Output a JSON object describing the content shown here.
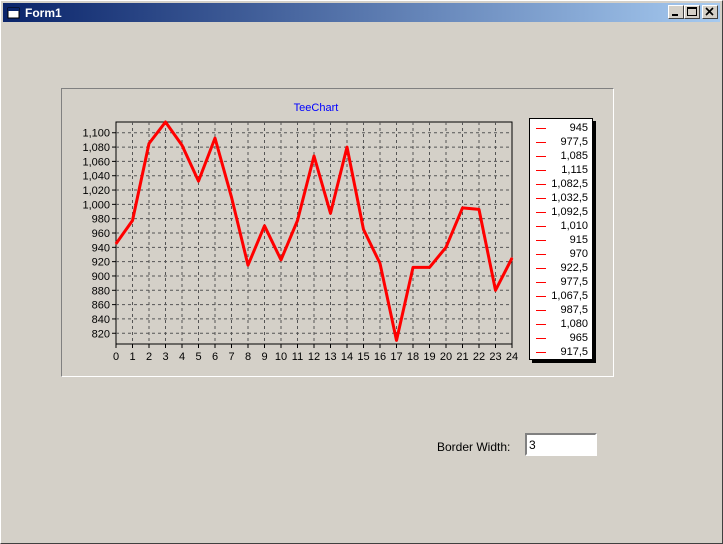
{
  "window": {
    "title": "Form1"
  },
  "chart_data": {
    "type": "line",
    "title": "TeeChart",
    "x": [
      0,
      1,
      2,
      3,
      4,
      5,
      6,
      7,
      8,
      9,
      10,
      11,
      12,
      13,
      14,
      15,
      16,
      17,
      18,
      19,
      20,
      21,
      22,
      23,
      24
    ],
    "series": [
      {
        "values": [
          945,
          977.5,
          1085,
          1115,
          1082.5,
          1032.5,
          1092.5,
          1010,
          915,
          970,
          922.5,
          977.5,
          1067.5,
          987.5,
          1080,
          965,
          917.5,
          810,
          912,
          912,
          940,
          995,
          993,
          880,
          925
        ],
        "color": "#ff0000"
      }
    ],
    "xticks": [
      "0",
      "1",
      "2",
      "3",
      "4",
      "5",
      "6",
      "7",
      "8",
      "9",
      "10",
      "11",
      "12",
      "13",
      "14",
      "15",
      "16",
      "17",
      "18",
      "19",
      "20",
      "21",
      "22",
      "23",
      "24"
    ],
    "yticks": [
      "820",
      "840",
      "860",
      "880",
      "900",
      "920",
      "940",
      "960",
      "980",
      "1,000",
      "1,020",
      "1,040",
      "1,060",
      "1,080",
      "1,100"
    ],
    "ylim": [
      805,
      1115
    ],
    "grid": true,
    "legend": [
      "945",
      "977,5",
      "1,085",
      "1,115",
      "1,082,5",
      "1,032,5",
      "1,092,5",
      "1,010",
      "915",
      "970",
      "922,5",
      "977,5",
      "1,067,5",
      "987,5",
      "1,080",
      "965",
      "917,5"
    ]
  },
  "form": {
    "border_width_label": "Border Width:",
    "border_width_value": "3"
  },
  "colors": {
    "title_bar_start": "#0a246a",
    "title_bar_end": "#a6caf0",
    "series": "#ff0000",
    "chart_title": "#0000ff",
    "window_bg": "#d4d0c8"
  }
}
